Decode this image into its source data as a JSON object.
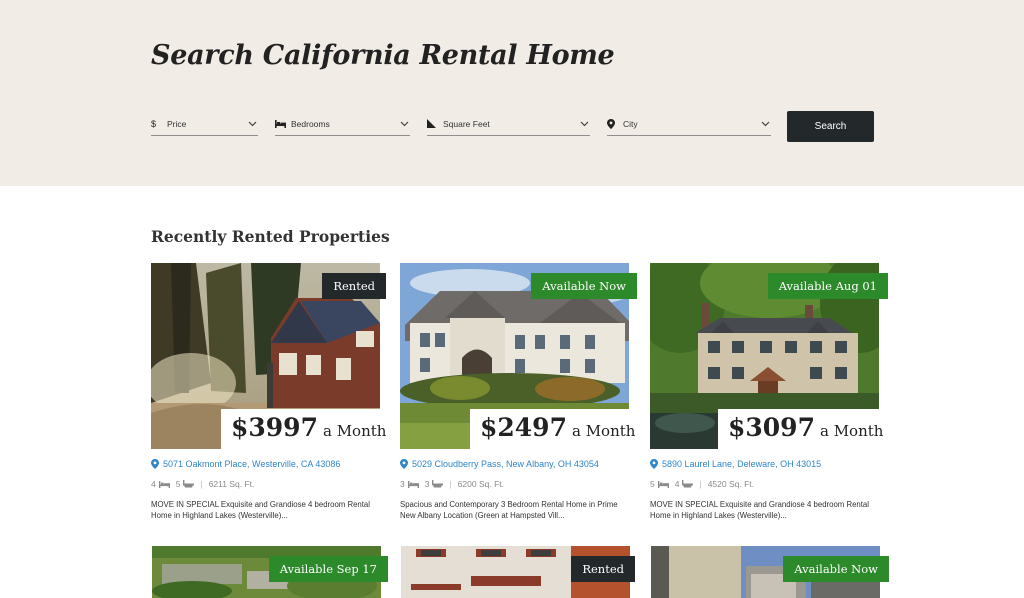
{
  "hero": {
    "title": "Search California Rental Home"
  },
  "filters": [
    {
      "icon": "dollar-icon",
      "label": "Price"
    },
    {
      "icon": "bed-icon",
      "label": "Bedrooms"
    },
    {
      "icon": "square-feet-icon",
      "label": "Square Feet"
    },
    {
      "icon": "location-pin-icon",
      "label": "City"
    }
  ],
  "search_button": "Search",
  "section_title": "Recently Rented Properties",
  "colors": {
    "available": "#2d8a2a",
    "rented": "#23282b",
    "link": "#2f86c8",
    "hero_bg": "#f1ece5"
  },
  "listings": [
    {
      "badge": "Rented",
      "price": "$3997",
      "unit": "a Month",
      "address": "5071 Oakmont Place, Westerville, CA 43086",
      "beds": "4",
      "baths": "5",
      "sqft": "6211 Sq. Ft.",
      "description": "MOVE IN SPECIAL Exquisite and Grandiose 4 bedroom Rental Home in Highland Lakes (Westerville)..."
    },
    {
      "badge": "Available Now",
      "price": "$2497",
      "unit": "a Month",
      "address": "5029 Cloudberry Pass, New Albany, OH 43054",
      "beds": "3",
      "baths": "3",
      "sqft": "6200 Sq. Ft.",
      "description": "Spacious and Contemporary 3 Bedroom Rental Home in Prime New Albany Location (Green at Hampsted Vill..."
    },
    {
      "badge": "Available Aug 01",
      "price": "$3097",
      "unit": "a Month",
      "address": "5890 Laurel Lane, Deleware, OH 43015",
      "beds": "5",
      "baths": "4",
      "sqft": "4520 Sq. Ft.",
      "description": "MOVE IN SPECIAL Exquisite and Grandiose 4 bedroom Rental Home in Highland Lakes (Westerville)..."
    },
    {
      "badge": "Available Sep 17"
    },
    {
      "badge": "Rented"
    },
    {
      "badge": "Available Now"
    }
  ]
}
